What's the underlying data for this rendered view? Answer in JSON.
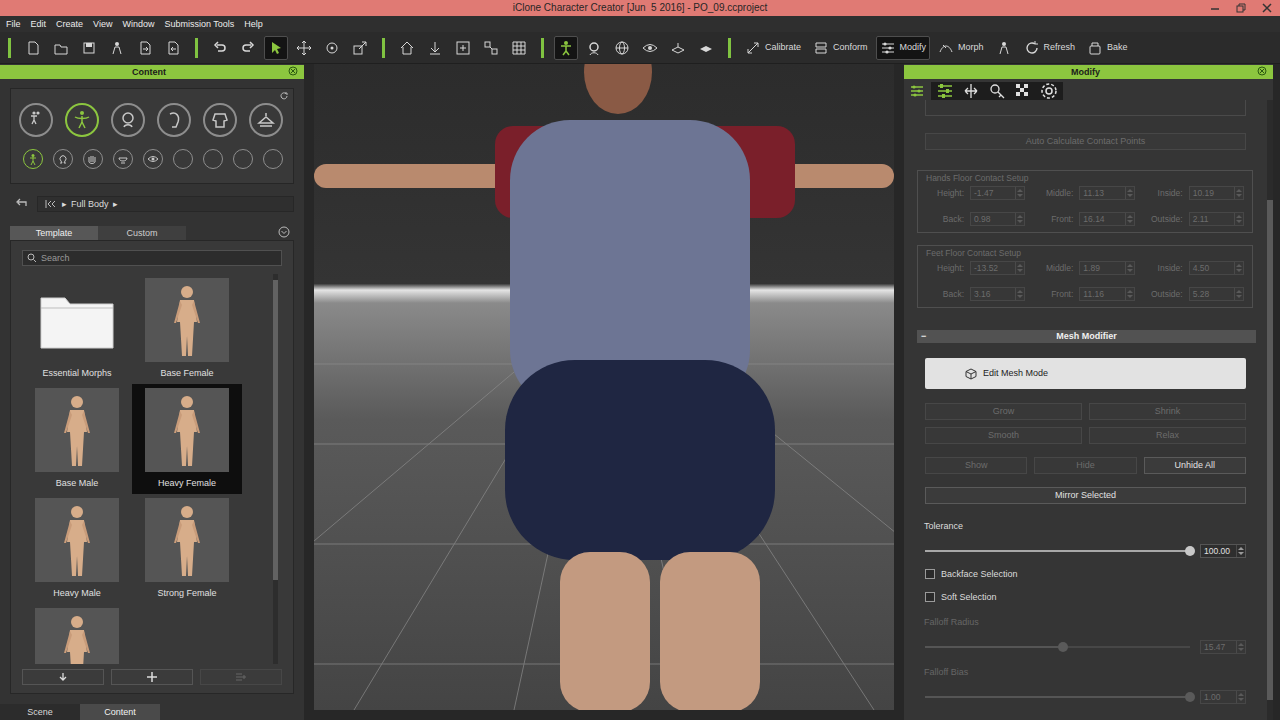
{
  "window": {
    "title": "iClone Character Creator [Jun  5 2016] - PO_09.ccproject"
  },
  "menu": [
    "File",
    "Edit",
    "Create",
    "View",
    "Window",
    "Submission Tools",
    "Help"
  ],
  "toolbar": {
    "groups": [
      [
        {
          "kind": "icon",
          "selected": false
        },
        {
          "kind": "icon",
          "selected": false
        },
        {
          "kind": "icon",
          "selected": false
        },
        {
          "kind": "icon",
          "selected": false
        },
        {
          "kind": "icon",
          "selected": false
        },
        {
          "kind": "icon",
          "selected": false
        }
      ],
      [
        {
          "kind": "icon",
          "selected": false
        },
        {
          "kind": "icon",
          "selected": false
        },
        {
          "kind": "icon",
          "selected": true
        },
        {
          "kind": "icon",
          "selected": false
        },
        {
          "kind": "icon",
          "selected": false
        },
        {
          "kind": "icon",
          "selected": false
        }
      ],
      [
        {
          "kind": "icon",
          "selected": false
        },
        {
          "kind": "icon",
          "selected": false
        },
        {
          "kind": "icon",
          "selected": false
        },
        {
          "kind": "icon",
          "selected": false
        },
        {
          "kind": "icon",
          "selected": false
        }
      ],
      [
        {
          "kind": "icon",
          "selected": true
        },
        {
          "kind": "icon",
          "selected": false
        },
        {
          "kind": "icon",
          "selected": false
        },
        {
          "kind": "icon",
          "selected": false
        },
        {
          "kind": "icon",
          "selected": false
        },
        {
          "kind": "icon",
          "selected": false
        }
      ],
      [
        {
          "kind": "button",
          "label": "Calibrate",
          "selected": false
        },
        {
          "kind": "button",
          "label": "Conform",
          "selected": false
        },
        {
          "kind": "button",
          "label": "Modify",
          "selected": true
        },
        {
          "kind": "button",
          "label": "Morph",
          "selected": false
        },
        {
          "kind": "icon",
          "selected": false
        },
        {
          "kind": "button",
          "label": "Refresh",
          "selected": false
        },
        {
          "kind": "button",
          "label": "Bake",
          "selected": false
        }
      ]
    ]
  },
  "content_panel": {
    "title": "Content",
    "categories": [
      {
        "selected": false
      },
      {
        "selected": true
      },
      {
        "selected": false
      },
      {
        "selected": false
      },
      {
        "selected": false
      },
      {
        "selected": false
      }
    ],
    "subcategories": [
      {
        "selected": true,
        "empty": false
      },
      {
        "selected": false,
        "empty": false
      },
      {
        "selected": false,
        "empty": false
      },
      {
        "selected": false,
        "empty": false
      },
      {
        "selected": false,
        "empty": false
      },
      {
        "selected": false,
        "empty": true
      },
      {
        "selected": false,
        "empty": true
      },
      {
        "selected": false,
        "empty": true
      },
      {
        "selected": false,
        "empty": true
      }
    ],
    "breadcrumb": {
      "separator": "▸",
      "items": [
        "Full Body"
      ]
    },
    "tabs": [
      {
        "label": "Template",
        "selected": true
      },
      {
        "label": "Custom",
        "selected": false
      }
    ],
    "search": {
      "placeholder": "Search"
    },
    "items": [
      {
        "label": "Essential Morphs",
        "kind": "folder",
        "selected": false
      },
      {
        "label": "Base Female",
        "kind": "figure",
        "selected": false
      },
      {
        "label": "Base Male",
        "kind": "figure",
        "selected": false
      },
      {
        "label": "Heavy Female",
        "kind": "figure",
        "selected": true
      },
      {
        "label": "Heavy Male",
        "kind": "figure",
        "selected": false
      },
      {
        "label": "Strong Female",
        "kind": "figure",
        "selected": false
      },
      {
        "kind": "figure",
        "selected": false
      }
    ],
    "actions": [
      {
        "disabled": false
      },
      {
        "disabled": false
      },
      {
        "disabled": true
      }
    ],
    "bottom_tabs": [
      {
        "label": "Scene",
        "selected": false
      },
      {
        "label": "Content",
        "selected": true
      }
    ]
  },
  "modify_panel": {
    "title": "Modify",
    "tab_icons": [
      {
        "selected": true
      },
      {
        "selected": false
      },
      {
        "selected": false
      },
      {
        "selected": false
      },
      {
        "selected": false
      }
    ],
    "auto_button": {
      "label": "Auto Calculate Contact Points",
      "disabled": true
    },
    "groups": [
      {
        "title": "Hands Floor Contact Setup",
        "disabled": true,
        "fields": [
          {
            "label": "Height:",
            "value": "-1.47"
          },
          {
            "label": "Middle:",
            "value": "11.13"
          },
          {
            "label": "Inside:",
            "value": "10.19"
          },
          {
            "label": "Back:",
            "value": "0.98"
          },
          {
            "label": "Front:",
            "value": "16.14"
          },
          {
            "label": "Outside:",
            "value": "2.11"
          }
        ]
      },
      {
        "title": "Feet Floor Contact Setup",
        "disabled": true,
        "fields": [
          {
            "label": "Height:",
            "value": "-13.52"
          },
          {
            "label": "Middle:",
            "value": "1.89"
          },
          {
            "label": "Inside:",
            "value": "4.50"
          },
          {
            "label": "Back:",
            "value": "3.16"
          },
          {
            "label": "Front:",
            "value": "11.16"
          },
          {
            "label": "Outside:",
            "value": "5.28"
          }
        ]
      }
    ],
    "mesh_modifier": {
      "collapse": "−",
      "title": "Mesh Modifier",
      "edit_button": {
        "label": "Edit Mesh Mode",
        "disabled": false
      },
      "button_rows": [
        [
          {
            "label": "Grow",
            "disabled": true
          },
          {
            "label": "Shrink",
            "disabled": true
          }
        ],
        [
          {
            "label": "Smooth",
            "disabled": true
          },
          {
            "label": "Relax",
            "disabled": true
          }
        ],
        [
          {
            "label": "Show",
            "disabled": true
          },
          {
            "label": "Hide",
            "disabled": true
          },
          {
            "label": "Unhide All",
            "disabled": false
          }
        ],
        [
          {
            "label": "Mirror Selected",
            "disabled": false
          }
        ]
      ],
      "controls": [
        {
          "kind": "slider",
          "label": "Tolerance",
          "value": "100.00",
          "level": 1,
          "disabled": false
        },
        {
          "kind": "checkbox",
          "label": "Backface Selection",
          "checked": false
        },
        {
          "kind": "checkbox",
          "label": "Soft Selection",
          "checked": false
        },
        {
          "kind": "slider",
          "label": "Falloff Radius",
          "value": "15.47",
          "level": 0.52,
          "disabled": true
        },
        {
          "kind": "slider",
          "label": "Falloff Bias",
          "value": "1.00",
          "level": 1,
          "disabled": true
        }
      ]
    }
  }
}
